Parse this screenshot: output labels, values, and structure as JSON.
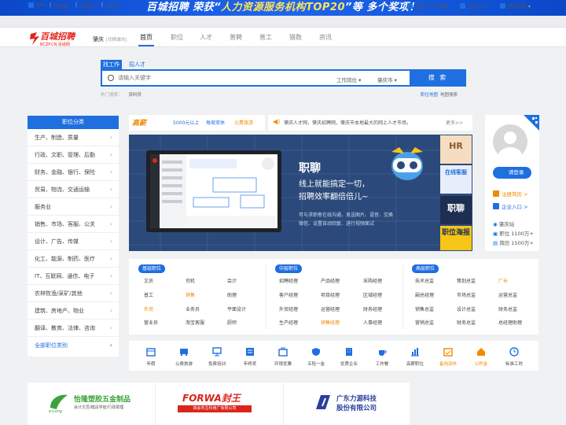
{
  "banner": {
    "logo_text": "百城招聘",
    "pre": "荣获“",
    "highlight": "人力资源服务机构TOP20",
    "post": "”等 多个奖项！"
  },
  "topbar": {
    "left": [
      "APP",
      "手机版",
      "小程序",
      "公众号"
    ],
    "right": [
      "注册 | 个人登录",
      "企业入口",
      "网站导航"
    ]
  },
  "header": {
    "logo_main": "百城招聘",
    "logo_sub": "BCZP.CN 百城网",
    "city": "肇庆",
    "switch_city": "[切换城市]",
    "nav": [
      "首页",
      "职位",
      "人才",
      "普聘",
      "普工",
      "猎数",
      "资讯"
    ]
  },
  "search": {
    "tabs": [
      "找工作",
      "招人才"
    ],
    "placeholder": "请输入关键字",
    "select_position": "工作岗位",
    "select_city": "肇庆市",
    "button": "搜 索",
    "hot_label": "热门搜索：",
    "hot_value": "资料员",
    "link_position_map": "职位地图",
    "link_map": "地图搜索"
  },
  "sidebar": {
    "title": "职位分类",
    "items": [
      "生产、制造、质量",
      "行政、文职、管理、后勤",
      "财务、金融、银行、保险",
      "贸易、物流、交通运输",
      "服务业",
      "销售、市场、客服、公关",
      "设计、广告、传媒",
      "化工、能源、制药、医疗",
      "IT、互联网、通信、电子",
      "农林牧渔/采矿/其他",
      "建筑、房地产、物业",
      "翻译、教育、法律、咨询",
      "全部职位类别"
    ]
  },
  "ticker": {
    "brand": "高薪",
    "tags": [
      "5000元以上",
      "每周双休",
      "公费旅游"
    ],
    "notice": "肇庆人才网，肇庆招聘网，肇庆市本地最大的网上人才市场。",
    "more": "更多>>"
  },
  "promo": {
    "title": "职聊",
    "sub1": "线上就能搞定一切，",
    "sub2": "招聘效率翻倍倍儿~",
    "desc1": "可与求职者在线沟通，发送图片、语音、交换",
    "desc2": "微信、设置自动回复、进行视频面试",
    "ads": [
      "HR",
      "在线客服",
      "职聊",
      "职位海报"
    ]
  },
  "login": {
    "button": "请登录",
    "register": "注册简历 >",
    "enterprise": "企业入口 >",
    "stat_title": "肇庆站",
    "stat_jobs": "职位 1100万+",
    "stat_resumes": "简历 1500万+"
  },
  "jobs": {
    "groups": [
      {
        "title": "基层职位",
        "rows": [
          [
            "文员",
            "司机",
            "会计"
          ],
          [
            "普工",
            "销售",
            "助理"
          ],
          [
            "外贸",
            "业务员",
            "平面设计"
          ],
          [
            "营业员",
            "淘宝客服",
            "厨师"
          ]
        ]
      },
      {
        "title": "中层职位",
        "rows": [
          [
            "招聘经理",
            "产品经理",
            "采购经理"
          ],
          [
            "客户经理",
            "项目经理",
            "区域经理"
          ],
          [
            "外贸经理",
            "运营经理",
            "财务经理"
          ],
          [
            "生产经理",
            "销售经理",
            "人事经理"
          ]
        ]
      },
      {
        "title": "高层职位",
        "rows": [
          [
            "技术总监",
            "策划总监",
            "厂长"
          ],
          [
            "副总经理",
            "市场总监",
            "运营总监"
          ],
          [
            "销售总监",
            "设计总监",
            "财务总监"
          ],
          [
            "营销总监",
            "财务总监",
            "总经理助理"
          ]
        ]
      }
    ],
    "orange": [
      "厂长",
      "销售",
      "外贸",
      "销售经理"
    ]
  },
  "quick": {
    "items": [
      "年假",
      "公费旅游",
      "免费培训",
      "年终奖",
      "环境优雅",
      "五险一金",
      "优质企业",
      "工作餐",
      "高薪职位",
      "备用双休",
      "公积金",
      "标准工时"
    ],
    "orange": [
      "备用双休",
      "公积金"
    ]
  },
  "logos": [
    {
      "name": "怡隆塑胶五金制品",
      "sub": "会计文员/模具学徒/行政助理",
      "brand": "e-Long"
    },
    {
      "name": "FORWA封王",
      "sub": "四会市主科用广有限公司"
    },
    {
      "name": "广东力源科技",
      "sub": "股份有限公司"
    }
  ],
  "colors": {
    "accent": "#1f6fe0",
    "orange": "#f08a00",
    "promo_bg": "#2b4a7b"
  }
}
